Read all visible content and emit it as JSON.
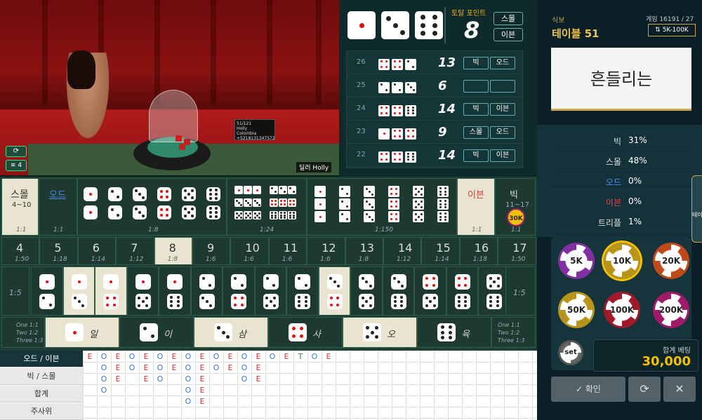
{
  "video": {
    "dealer_name": "딜러 Holly",
    "card_lines": [
      "51/121",
      "Holly",
      "Colombia",
      "+5218131347572"
    ],
    "viewers": "4"
  },
  "latest": {
    "dice": [
      1,
      3,
      6
    ],
    "total_label": "토탈 포인트",
    "total": "8",
    "small_label": "스몰",
    "even_label": "이븐"
  },
  "history": [
    {
      "round": "26",
      "dice": [
        4,
        4,
        2
      ],
      "sum": "13",
      "a": "빅",
      "b": "오드"
    },
    {
      "round": "25",
      "dice": [
        2,
        2,
        3
      ],
      "sum": "6",
      "a": "",
      "b": ""
    },
    {
      "round": "24",
      "dice": [
        4,
        4,
        6
      ],
      "sum": "14",
      "a": "빅",
      "b": "이븐"
    },
    {
      "round": "23",
      "dice": [
        1,
        4,
        4
      ],
      "sum": "9",
      "a": "스몰",
      "b": "오드"
    },
    {
      "round": "22",
      "dice": [
        4,
        4,
        6
      ],
      "sum": "14",
      "a": "빅",
      "b": "이븐"
    }
  ],
  "right": {
    "section": "식보",
    "table": "테이블 51",
    "game_label": "게임 16191 / 27",
    "limit": "5K-100K",
    "status": "흔들리는",
    "stats": [
      {
        "label": "빅",
        "value": "31%",
        "color": "#dddddd"
      },
      {
        "label": "스몰",
        "value": "48%",
        "color": "#dddddd"
      },
      {
        "label": "오드",
        "value": "0%",
        "color": "#4a8ae8"
      },
      {
        "label": "이븐",
        "value": "0%",
        "color": "#e84a4a"
      },
      {
        "label": "트리플",
        "value": "1%",
        "color": "#dddddd"
      }
    ],
    "chips": [
      "5K",
      "10K",
      "20K",
      "50K",
      "100K",
      "200K"
    ],
    "set": "set",
    "total_bet_label": "합계 베팅",
    "total_bet": "30,000",
    "confirm": "확인",
    "side_tab": "테이"
  },
  "board": {
    "small": "스몰",
    "small_range": "4~10",
    "odd": "오드",
    "even": "이븐",
    "big": "빅",
    "big_range": "11~17",
    "big_chip": "30K",
    "odds": {
      "one_one": "1:1",
      "one_eight": "1:8",
      "one_24": "1:24",
      "one_150": "1:150",
      "one_five": "1:5"
    },
    "totals": [
      {
        "n": "4",
        "o": "1:50"
      },
      {
        "n": "5",
        "o": "1:18"
      },
      {
        "n": "6",
        "o": "1:14"
      },
      {
        "n": "7",
        "o": "1:12"
      },
      {
        "n": "8",
        "o": "1:8"
      },
      {
        "n": "9",
        "o": "1:6"
      },
      {
        "n": "10",
        "o": "1:6"
      },
      {
        "n": "11",
        "o": "1:6"
      },
      {
        "n": "12",
        "o": "1:6"
      },
      {
        "n": "13",
        "o": "1:8"
      },
      {
        "n": "14",
        "o": "1:12"
      },
      {
        "n": "15",
        "o": "1:14"
      },
      {
        "n": "16",
        "o": "1:18"
      },
      {
        "n": "17",
        "o": "1:50"
      }
    ],
    "singles": [
      "일",
      "이",
      "삼",
      "사",
      "오",
      "육"
    ],
    "single_odds": [
      "One 1:1",
      "Two 1:2",
      "Three 1:3"
    ]
  },
  "road": {
    "labels": [
      "오드 / 이븐",
      "빅 / 스몰",
      "합계",
      "주사위"
    ],
    "row1": [
      "E",
      "O",
      "E",
      "O",
      "E",
      "O",
      "E",
      "O",
      "E",
      "O",
      "E",
      "O",
      "E",
      "O",
      "E",
      "T",
      "O",
      "E"
    ],
    "row2": [
      "",
      "O",
      "E",
      "O",
      "E",
      "O",
      "E",
      "O",
      "E",
      "O",
      "E",
      "O",
      "E"
    ],
    "row3": [
      "",
      "O",
      "E",
      "",
      "E",
      "O",
      "",
      "O",
      "E",
      "",
      "",
      "O",
      "E"
    ],
    "row4": [
      "",
      "O",
      "",
      "",
      "",
      "",
      "",
      "O",
      "E"
    ],
    "row5": [
      "",
      "",
      "",
      "",
      "",
      "",
      "",
      "O",
      "E"
    ]
  },
  "colors": {
    "accent": "#c9a84a",
    "odd": "#3b7bd8",
    "even": "#d83b3b"
  }
}
